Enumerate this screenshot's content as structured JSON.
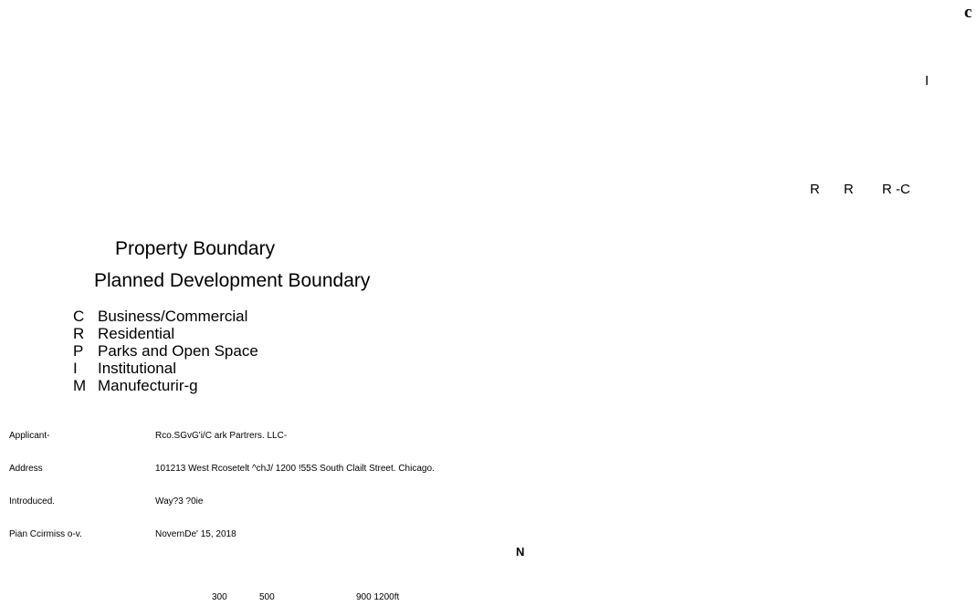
{
  "map_labels": {
    "corner_letter": "c",
    "label_i": "I",
    "zone_r1": "R",
    "zone_r2": "R",
    "zone_rc": "R -C"
  },
  "legend": {
    "property_boundary": "Property Boundary",
    "planned_development_boundary": "Planned Development Boundary",
    "zones": [
      {
        "code": "C",
        "label": "Business/Commercial"
      },
      {
        "code": "R",
        "label": "Residential"
      },
      {
        "code": "P",
        "label": "Parks and Open Space"
      },
      {
        "code": "I",
        "label": "Institutional"
      },
      {
        "code": "M",
        "label": "Manufecturir-g"
      }
    ]
  },
  "info": [
    {
      "label": "Applicant-",
      "value": "Rco.SGvG'i/C ark Partrers. LLC-"
    },
    {
      "label": "Address",
      "value": "101213 West Rcosetelt ^chJ/ 1200 !55S South Clailt Street. Chicago."
    },
    {
      "label": "Introduced.",
      "value": "Way?3 ?0ie"
    },
    {
      "label": "Pian Ccirmiss o-v.",
      "value": "NovernDe' 15, 2018"
    }
  ],
  "north_arrow": "N",
  "scale_bar": {
    "ticks": [
      "300",
      "500",
      "900 1200ft"
    ]
  }
}
